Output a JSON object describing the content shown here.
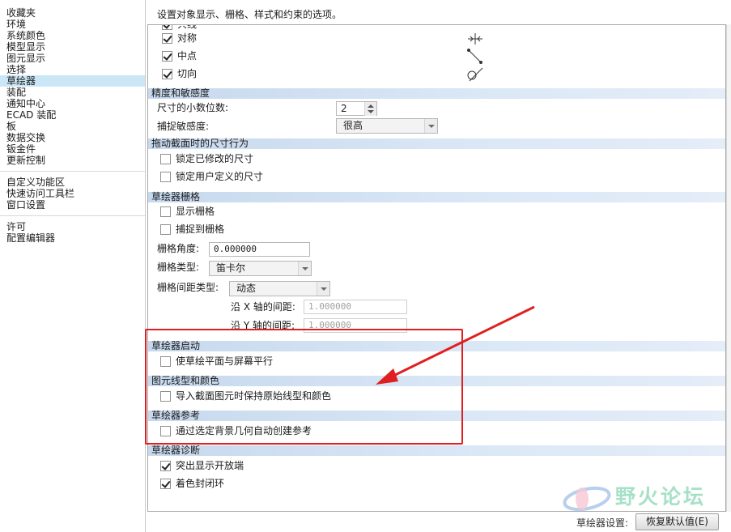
{
  "nav": {
    "group1": [
      "收藏夹",
      "环境",
      "系统颜色",
      "模型显示",
      "图元显示",
      "选择",
      "草绘器",
      "装配",
      "通知中心",
      "ECAD 装配",
      "板",
      "数据交换",
      "钣金件",
      "更新控制"
    ],
    "group2": [
      "自定义功能区",
      "快速访问工具栏",
      "窗口设置"
    ],
    "group3": [
      "许可",
      "配置编辑器"
    ],
    "selected": "草绘器"
  },
  "description": "设置对象显示、栅格、样式和约束的选项。",
  "constraints": {
    "partial_label": "共线",
    "items": [
      {
        "label": "对称",
        "checked": true,
        "icon": "symmetric-constraint-icon"
      },
      {
        "label": "中点",
        "checked": true,
        "icon": "midpoint-constraint-icon"
      },
      {
        "label": "切向",
        "checked": true,
        "icon": "tangent-constraint-icon"
      }
    ]
  },
  "precision": {
    "header": "精度和敏感度",
    "decimals_label": "尺寸的小数位数:",
    "decimals_value": "2",
    "snap_label": "捕捉敏感度:",
    "snap_value": "很高"
  },
  "drag": {
    "header": "拖动截面时的尺寸行为",
    "items": [
      {
        "label": "锁定已修改的尺寸",
        "checked": false
      },
      {
        "label": "锁定用户定义的尺寸",
        "checked": false
      }
    ]
  },
  "grid": {
    "header": "草绘器栅格",
    "show_label": "显示栅格",
    "show_checked": false,
    "snap_label": "捕捉到栅格",
    "snap_checked": false,
    "angle_label": "栅格角度:",
    "angle_value": "0.000000",
    "type_label": "栅格类型:",
    "type_value": "笛卡尔",
    "spacing_type_label": "栅格间距类型:",
    "spacing_type_value": "动态",
    "x_label": "沿 X 轴的间距:",
    "x_value": "1.000000",
    "y_label": "沿 Y 轴的间距:",
    "y_value": "1.000000"
  },
  "startup": {
    "header": "草绘器启动",
    "item": "使草绘平面与屏幕平行",
    "checked": false
  },
  "linestyle": {
    "header": "图元线型和颜色",
    "item": "导入截面图元时保持原始线型和颜色",
    "checked": false
  },
  "reference": {
    "header": "草绘器参考",
    "item": "通过选定背景几何自动创建参考",
    "checked": false
  },
  "diagnostics": {
    "header": "草绘器诊断",
    "items": [
      {
        "label": "突出显示开放端",
        "checked": true
      },
      {
        "label": "着色封闭环",
        "checked": true
      }
    ]
  },
  "footer": {
    "settings_label": "草绘器设置:",
    "restore_button": "恢复默认值(E)"
  },
  "watermark": "野火论坛",
  "colors": {
    "section_header": "#c7d9ee",
    "selection": "#cbe7f7",
    "annotation": "#e02020",
    "watermark": "#a7e0c8"
  }
}
